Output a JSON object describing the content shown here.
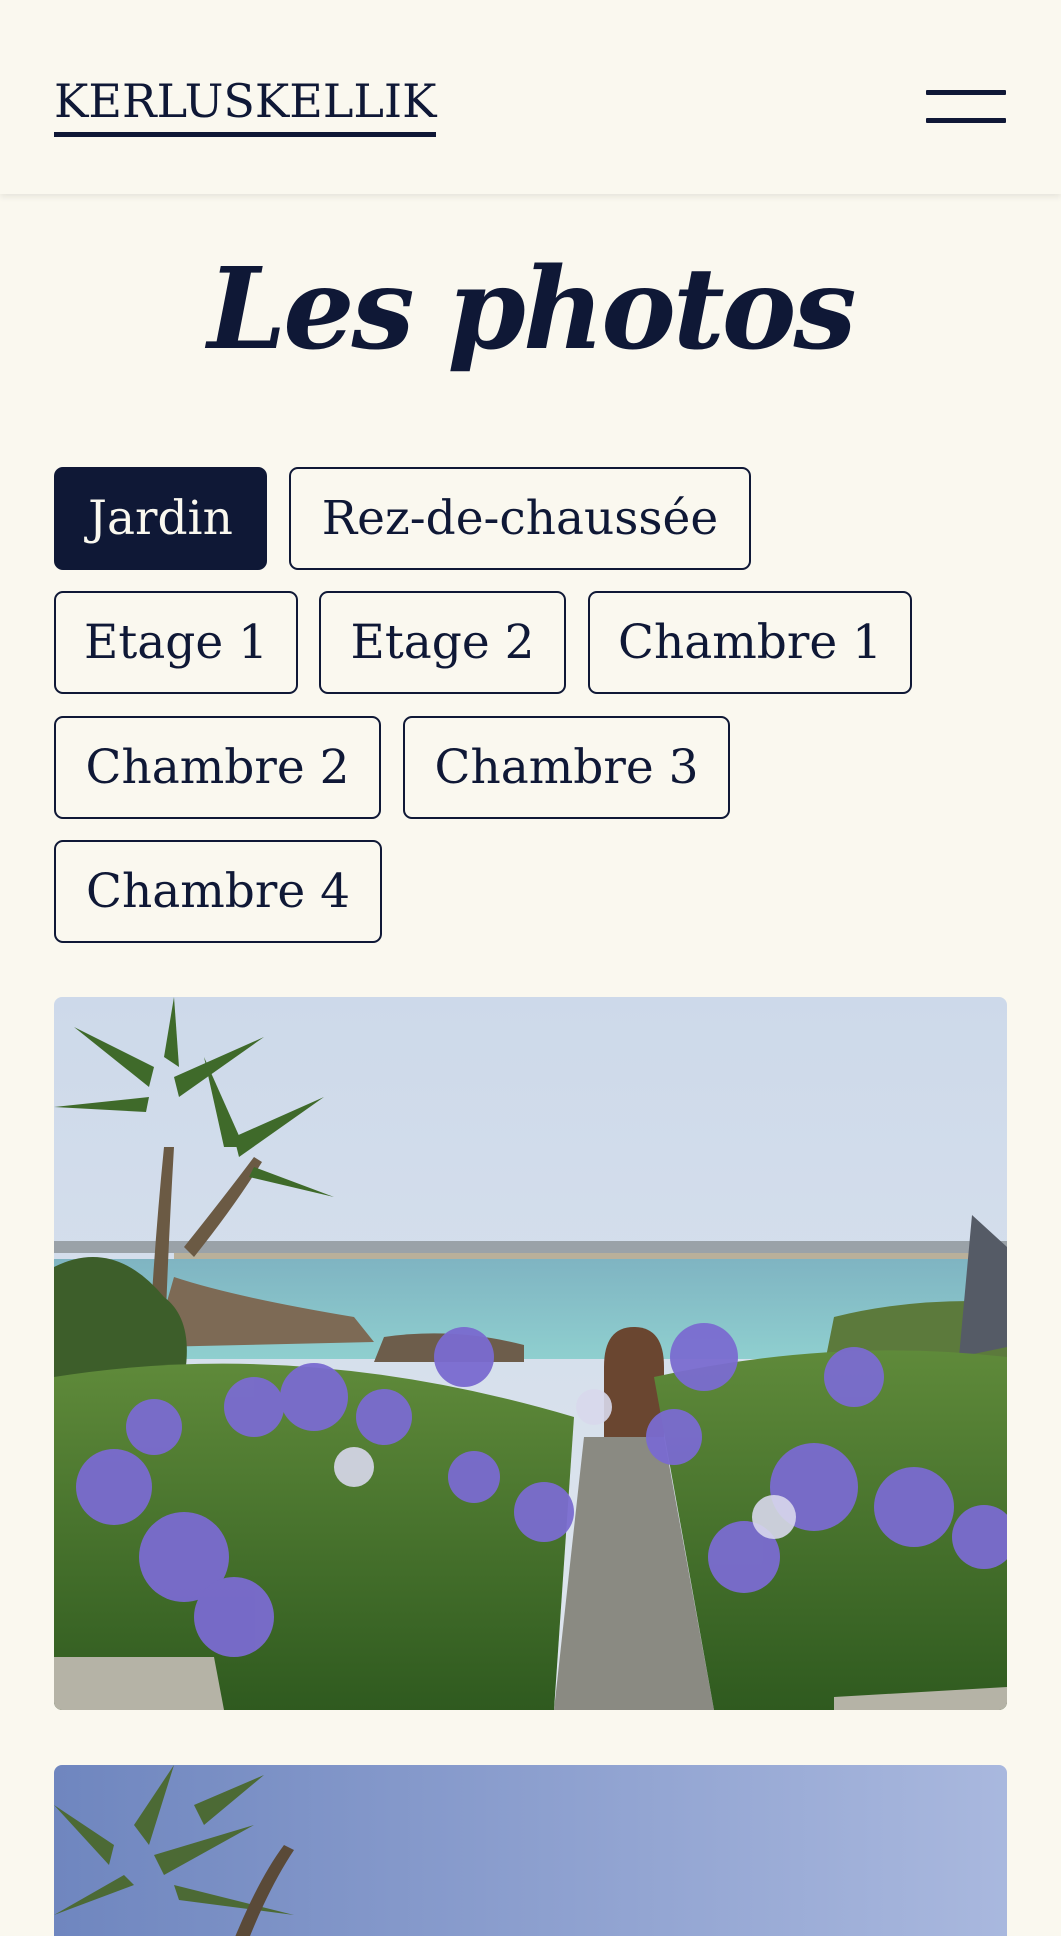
{
  "header": {
    "logo": "KERLUSKELLIK",
    "menu_icon": "hamburger-menu-icon"
  },
  "page": {
    "title": "Les photos"
  },
  "filters": [
    {
      "label": "Jardin",
      "active": true
    },
    {
      "label": "Rez-de-chaussée",
      "active": false
    },
    {
      "label": "Etage 1",
      "active": false
    },
    {
      "label": "Etage 2",
      "active": false
    },
    {
      "label": "Chambre 1",
      "active": false
    },
    {
      "label": "Chambre 2",
      "active": false
    },
    {
      "label": "Chambre 3",
      "active": false
    },
    {
      "label": "Chambre 4",
      "active": false
    }
  ],
  "colors": {
    "background": "#faf8ef",
    "primary": "#0f1836"
  }
}
